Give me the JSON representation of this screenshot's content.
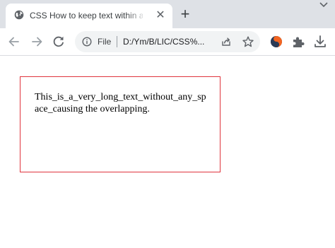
{
  "browser": {
    "tab": {
      "title": "CSS How to keep text within a box",
      "favicon": "globe-icon",
      "close_icon": "close-icon"
    },
    "new_tab_icon": "plus-icon",
    "tab_search_icon": "chevron-down-icon",
    "toolbar": {
      "back_icon": "arrow-left-icon",
      "forward_icon": "arrow-right-icon",
      "reload_icon": "reload-icon",
      "site_info_icon": "info-icon",
      "file_label": "File",
      "url": "D:/Ym/B/LIC/CSS%...",
      "share_icon": "share-icon",
      "bookmark_icon": "star-icon",
      "extension_icon": "extension-logo-icon",
      "extensions_menu_icon": "puzzle-icon",
      "downloads_icon": "download-icon"
    }
  },
  "page": {
    "box_text": "This_is_a_very_long_text_without_any_space_causing the overlapping.",
    "box_border_color": "#e0343d"
  }
}
